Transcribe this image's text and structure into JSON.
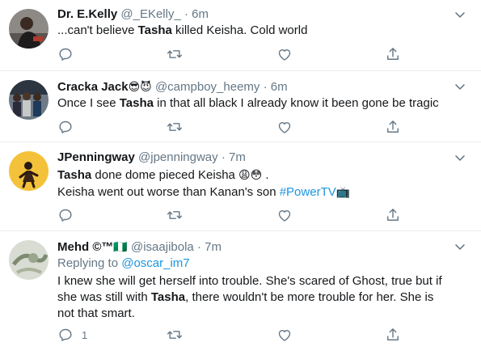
{
  "tweets": [
    {
      "name": "Dr. E.Kelly",
      "handle": "@_EKelly_",
      "sep": "·",
      "time": "6m",
      "text_pre": "...can't believe ",
      "text_bold": "Tasha",
      "text_post": " killed Keisha. Cold world"
    },
    {
      "name": "Cracka Jack",
      "name_emoji": "😎😈",
      "handle": "@campboy_heemy",
      "sep": "·",
      "time": "6m",
      "text_pre": "Once I see ",
      "text_bold": "Tasha",
      "text_post": " in that all black I already know it been gone be tragic"
    },
    {
      "name": "JPenningway",
      "handle": "@jpenningway",
      "sep": "·",
      "time": "7m",
      "line1_bold": "Tasha",
      "line1_post": " done dome pieced Keisha ",
      "line1_emoji": "😩😳",
      "line1_end": " .",
      "line2_pre": "Keisha went out worse than Kanan's son ",
      "hashtag": "#PowerTV",
      "line2_emoji": "📺"
    },
    {
      "name": "Mehd ©™",
      "name_flag": "🇳🇬",
      "handle": "@isaajibola",
      "sep": "·",
      "time": "7m",
      "replying_label": "Replying to ",
      "replying_handle": "@oscar_im7",
      "text_pre": "I knew she will get herself into trouble. She's scared of Ghost, true but if she was still with ",
      "text_bold": "Tasha",
      "text_post": ", there wouldn't be more trouble for her. She is not that smart.",
      "reply_count": "1"
    }
  ],
  "icons": {
    "reply": "reply-icon",
    "retweet": "retweet-icon",
    "like": "like-icon",
    "share": "share-icon",
    "menu": "chevron-down-icon"
  },
  "colors": {
    "icon": "#657786",
    "link": "#1b95e0",
    "divider": "#e6ecf0"
  }
}
